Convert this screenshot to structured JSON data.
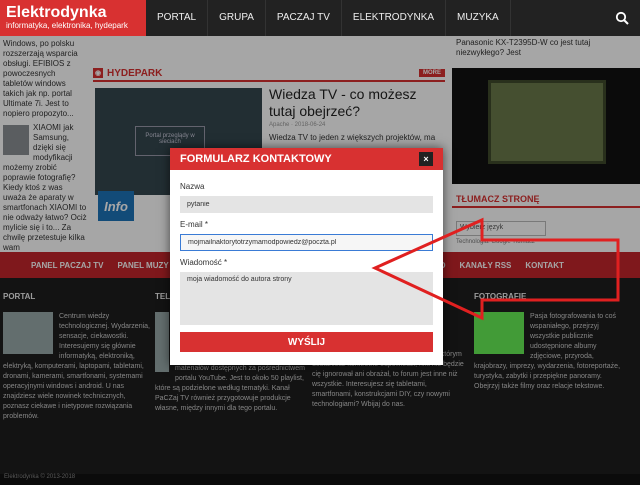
{
  "site": {
    "title": "Elektrodynka",
    "subtitle": "informatyka, elektronika, hydepark"
  },
  "nav": {
    "items": [
      "PORTAL",
      "GRUPA",
      "PACZAJ TV",
      "ELEKTRODYNKA",
      "MUZYKA"
    ]
  },
  "left_col": {
    "text1": "Windows, po polsku rozszerzają wsparcia obsługi. EFIBIOS z powoczesnych tabletów windows takich jak np. portal Ultimate 7i. Jest to nopiero propozyto...",
    "text2": "XIAOMI jak Samsung, dzięki się modyfikacji możemy zrobić poprawie fotografię? Kiedy ktoś z was uważa że aparaty w smartfonach XIAOMI to nie odważy łatwo? Ociż mylicie się i to... Za chwilę przetestuje kilka wam"
  },
  "hydepark": {
    "label": "HYDEPARK",
    "more": "MORE",
    "image_text": "Portal przeglądy w sieciach"
  },
  "article": {
    "title": "Wiedza TV - co możesz tutaj obejrzeć?",
    "meta": "Apache · 2018-06-24",
    "excerpt": "Wiedza TV to jeden z większych projektów, ma"
  },
  "info_logo": "Info",
  "right_col": {
    "text": "Panasonic KX-T2395D-W co jest tutaj niezwykłego? Jest"
  },
  "translate": {
    "heading": "TŁUMACZ STRONĘ",
    "select": "Wybierz język",
    "powered": "Technologia: Google Tłumacz"
  },
  "red_menu": {
    "items": [
      "PANEL PACZAJ TV",
      "PANEL MUZY",
      "OAD",
      "KANAŁY RSS",
      "KONTAKT"
    ]
  },
  "footer": {
    "col1_heading": "PORTAL",
    "col1_text": "Centrum wiedzy technologicznej. Wydarzenia, sensacje, ciekawostki. Interesujemy się głównie informatyką, elektroniką, elektryką, komputerami, laptopami, tabletami, dronami, kamerami, smartfonami, systemami operacyjnymi windows i android. U nas znajdziesz wiele nowinek technicznych, poznasz ciekawe i nietypowe rozwiązania problemów.",
    "col2_heading": "TELE",
    "col2_text": "materiałów dostępnych za pośrednictwem portalu YouTube. Jest to około 50 playlist, które są podzielone według tematyki. Kanał PaCZaj TV również przygotowuje produkcje własne, między innymi dla tego portalu.",
    "col3_text": "moderatorzy nie są nadgorliwi. Forum na którym dostaniesz konkretne odpowiedzi, nikt nie będzie cię ignorował ani obrażał, to forum jest inne niż wszystkie. Interesujesz się tabletami, smartfonami, konstrukcjami DIY, czy nowymi technologiami? Wbijaj do nas.",
    "col4_heading": "FOTOGRAFIE",
    "col4_text": "Pasja fotografowania to coś wspaniałego, przejrzyj wszystkie publicznie udostępnione albumy zdjęciowe, przyroda, krajobrazy, imprezy, wydarzenia, fotoreportaże, turystyka, zabytki i przepiękne panoramy. Obejrzyj także filmy oraz relacje tekstowe."
  },
  "bottom_bar": "Elektrodynka © 2013-2018",
  "modal": {
    "title": "FORMULARZ KONTAKTOWY",
    "close": "×",
    "name_label": "Nazwa",
    "name_value": "pytanie",
    "email_label": "E-mail *",
    "email_value": "mojmailnaktorytotrzymamodpowiedz@poczta.pl",
    "message_label": "Wiadomość *",
    "message_value": "moja wiadomość do autora strony",
    "send_label": "WYŚLIJ"
  },
  "colors": {
    "accent": "#d83131",
    "arrow": "#e02020",
    "dark": "#222222"
  }
}
